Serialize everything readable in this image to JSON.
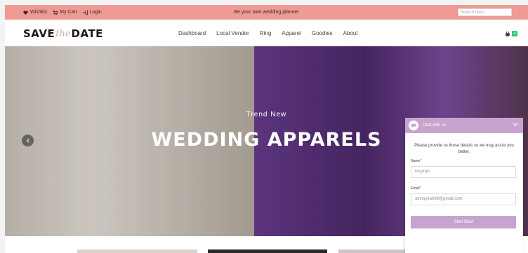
{
  "topbar": {
    "wishlist": "Wishlist",
    "cart": "My Cart",
    "login": "Login",
    "tagline": "Be your own wedding planner",
    "search_placeholder": "Search here..."
  },
  "logo": {
    "left": "SAVE",
    "middle": "the",
    "right": "DATE"
  },
  "nav": {
    "items": [
      "Dashboard",
      "Local Vendor",
      "Ring",
      "Apparel",
      "Goodies",
      "About"
    ],
    "cart_count": "0"
  },
  "hero": {
    "kicker": "Trend New",
    "headline": "WEDDING APPARELS"
  },
  "chat": {
    "title": "Chat with us",
    "intro": "Please provide us these details so we may assist you better.",
    "name_label": "Name*",
    "name_value": "insyirah",
    "email_label": "Email*",
    "email_value": "ainnsyirah98@gmail.com",
    "button": "Start Chat"
  },
  "colors": {
    "topbar": "#ef9a92",
    "chat_accent": "#c7a4cf",
    "cart_badge": "#2ecc71"
  },
  "icons": [
    "heart-icon",
    "cart-icon",
    "login-icon",
    "chevron-left-icon",
    "chat-bubble-icon",
    "chevron-down-icon"
  ]
}
